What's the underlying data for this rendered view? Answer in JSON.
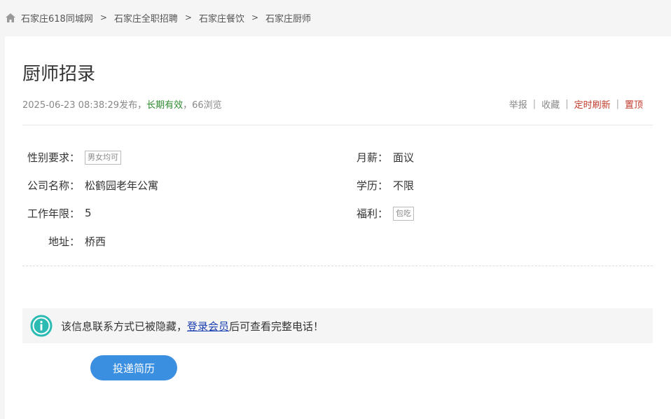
{
  "breadcrumb": {
    "items": [
      "石家庄618同城网",
      "石家庄全职招聘",
      "石家庄餐饮",
      "石家庄厨师"
    ],
    "separator": ">"
  },
  "post": {
    "title": "厨师招录",
    "date": "2025-06-23 08:38:29发布，",
    "validity": "长期有效",
    "views": "，66浏览"
  },
  "actions": {
    "report": "举报",
    "favorite": "收藏",
    "refresh": "定时刷新",
    "top": "置顶",
    "pipe": "|"
  },
  "details": {
    "gender_label": "性别要求：",
    "gender_value": "男女均可",
    "salary_label": "月薪：",
    "salary_value": "面议",
    "company_label": "公司名称：",
    "company_value": "松鹤园老年公寓",
    "education_label": "学历：",
    "education_value": "不限",
    "experience_label": "工作年限：",
    "experience_value": "5",
    "benefits_label": "福利：",
    "benefits_value": "包吃",
    "address_label": "地址：",
    "address_value": "桥西"
  },
  "notice": {
    "prefix": "该信息联系方式已被隐藏，",
    "link": "登录会员",
    "suffix": "后可查看完整电话！"
  },
  "apply": {
    "label": "投递简历"
  },
  "colors": {
    "accent": "#3a8fe0",
    "valid_green": "#2e8b2e",
    "action_red": "#c0392b",
    "info_teal": "#2bbbb3"
  }
}
